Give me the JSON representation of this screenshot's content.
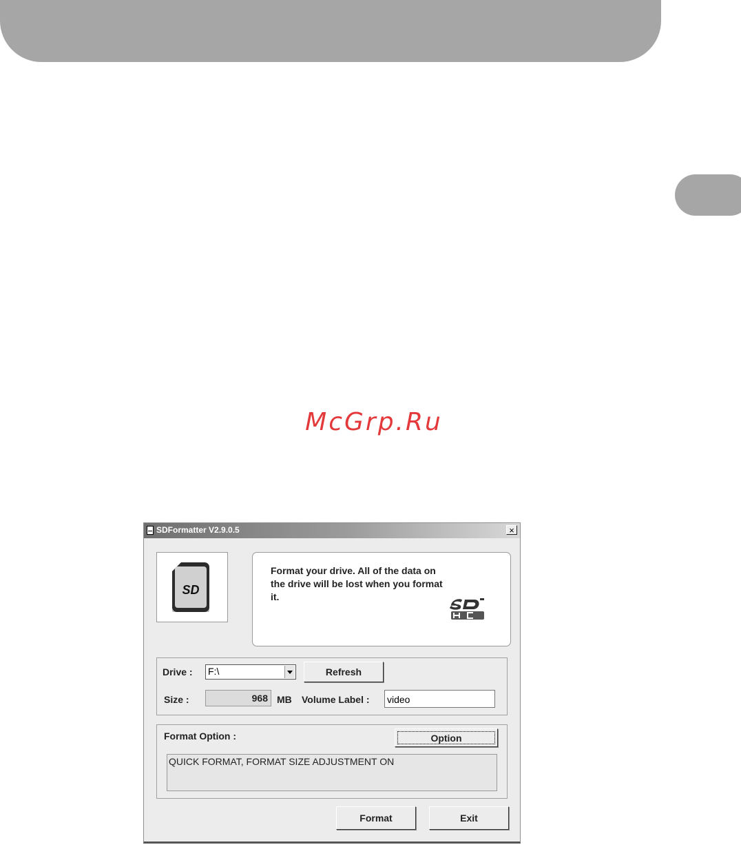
{
  "watermark": "McGrp.Ru",
  "window": {
    "title": "SDFormatter V2.9.0.5",
    "close_glyph": "×",
    "message": "Format your drive. All of the data on the drive will be lost when you format it.",
    "sd_card_label": "SD",
    "logo_name": "sdhc-logo-icon"
  },
  "drive": {
    "label": "Drive :",
    "selected": "F:\\",
    "refresh_label": "Refresh",
    "size_label": "Size  :",
    "size_value": "968",
    "size_unit": "MB",
    "volume_label_label": "Volume Label  :",
    "volume_label_value": "video"
  },
  "format_option": {
    "label": "Format Option :",
    "option_button": "Option",
    "info": "QUICK FORMAT, FORMAT SIZE ADJUSTMENT ON"
  },
  "actions": {
    "format_label": "Format",
    "exit_label": "Exit"
  },
  "colors": {
    "banner": "#a6a6a6",
    "watermark": "#e4393b",
    "window_bg": "#ececec"
  }
}
